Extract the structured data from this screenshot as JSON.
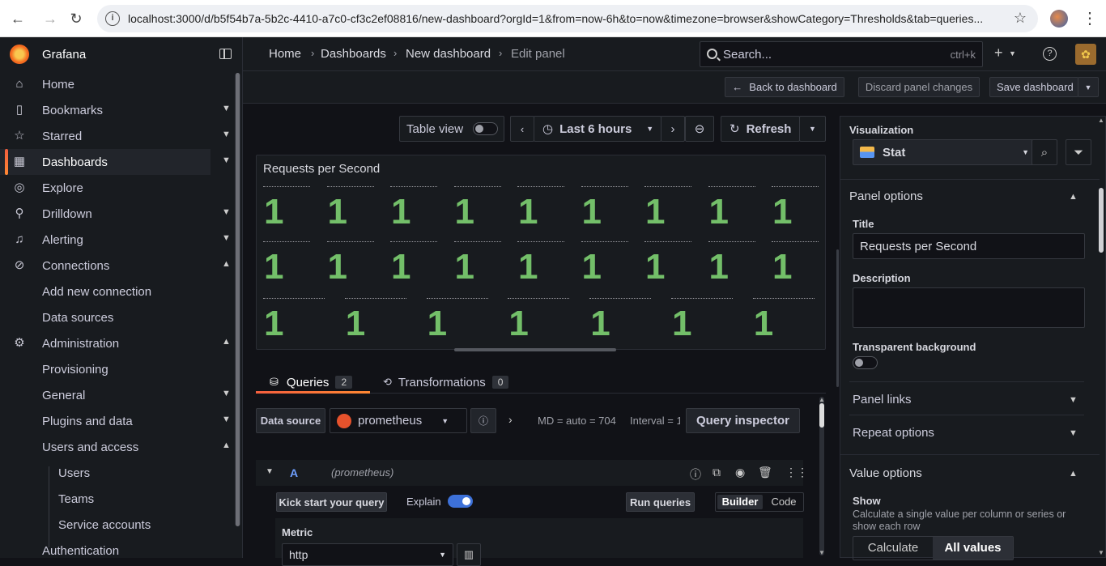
{
  "browser": {
    "url": "localhost:3000/d/b5f54b7a-5b2c-4410-a7c0-cf3c2ef08816/new-dashboard?orgId=1&from=now-6h&to=now&timezone=browser&showCategory=Thresholds&tab=queries..."
  },
  "sidebar": {
    "brand": "Grafana",
    "items": [
      {
        "label": "Home"
      },
      {
        "label": "Bookmarks"
      },
      {
        "label": "Starred"
      },
      {
        "label": "Dashboards"
      },
      {
        "label": "Explore"
      },
      {
        "label": "Drilldown"
      },
      {
        "label": "Alerting"
      },
      {
        "label": "Connections"
      },
      {
        "label": "Add new connection"
      },
      {
        "label": "Data sources"
      },
      {
        "label": "Administration"
      },
      {
        "label": "Provisioning"
      },
      {
        "label": "General"
      },
      {
        "label": "Plugins and data"
      },
      {
        "label": "Users and access"
      },
      {
        "label": "Users"
      },
      {
        "label": "Teams"
      },
      {
        "label": "Service accounts"
      },
      {
        "label": "Authentication"
      }
    ]
  },
  "breadcrumb": {
    "home": "Home",
    "dashboards": "Dashboards",
    "dashboard": "New dashboard",
    "current": "Edit panel"
  },
  "search": {
    "placeholder": "Search...",
    "shortcut": "ctrl+k"
  },
  "toolbar": {
    "back": "Back to dashboard",
    "discard": "Discard panel changes",
    "save": "Save dashboard"
  },
  "controls": {
    "table_view": "Table view",
    "time_range": "Last 6 hours",
    "refresh": "Refresh"
  },
  "panel": {
    "title": "Requests per Second",
    "values": [
      "1",
      "1",
      "1",
      "1",
      "1",
      "1",
      "1",
      "1",
      "1",
      "1",
      "1",
      "1",
      "1",
      "1",
      "1",
      "1",
      "1",
      "1",
      "1",
      "1",
      "1",
      "1",
      "1",
      "1",
      "1"
    ]
  },
  "tabs": {
    "queries": "Queries",
    "queries_count": "2",
    "transformations": "Transformations",
    "transformations_count": "0"
  },
  "query": {
    "data_source_label": "Data source",
    "data_source": "prometheus",
    "md": "MD = auto = 704",
    "interval": "Interval = 1",
    "inspector": "Query inspector",
    "ref_id": "A",
    "ds_hint": "(prometheus)",
    "kick_start": "Kick start your query",
    "explain": "Explain",
    "run": "Run queries",
    "builder": "Builder",
    "code": "Code",
    "metric_label": "Metric",
    "metric_value": "http"
  },
  "options": {
    "visualization_label": "Visualization",
    "visualization": "Stat",
    "panel_options": "Panel options",
    "title_label": "Title",
    "title_value": "Requests per Second",
    "description_label": "Description",
    "transparent_label": "Transparent background",
    "panel_links": "Panel links",
    "repeat_options": "Repeat options",
    "value_options": "Value options",
    "show_label": "Show",
    "show_desc": "Calculate a single value per column or series or show each row",
    "calculate": "Calculate",
    "all_values": "All values"
  },
  "colors": {
    "stat_value": "#73bf69",
    "accent": "#f55f3e",
    "toggle_on": "#3d71d9"
  }
}
